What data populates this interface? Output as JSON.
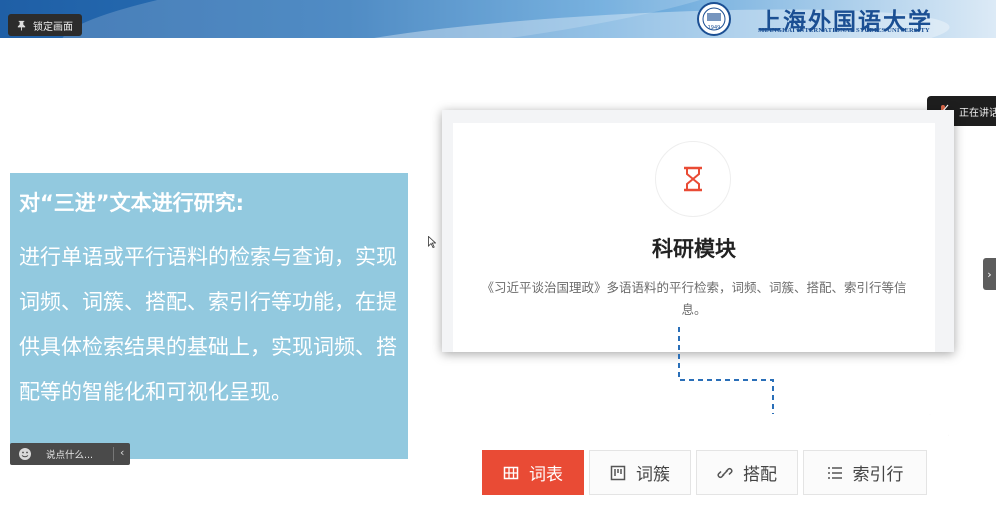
{
  "header": {
    "lock_label": "锁定画面",
    "university_name": "上海外国语大学",
    "university_name_en": "SHANGHAI INTERNATIONAL STUDIES UNIVERSITY",
    "logo_year": "1949"
  },
  "speaking_label": "正在讲话",
  "left_panel": {
    "heading": "对“三进”文本进行研究:",
    "body": "进行单语或平行语料的检索与查询，实现词频、词簇、搭配、索引行等功能，在提供具体检索结果的基础上，实现词频、搭配等的智能化和可视化呈现。"
  },
  "chat": {
    "placeholder": "说点什么...",
    "collapse_glyph": "‹"
  },
  "module_card": {
    "title": "科研模块",
    "description": "《习近平谈治国理政》多语语料的平行检索，词频、词簇、搭配、索引行等信息。",
    "icon": "hourglass-icon",
    "accent_color": "#e94b35"
  },
  "tools": [
    {
      "label": "词表",
      "icon": "table-icon",
      "active": true
    },
    {
      "label": "词簇",
      "icon": "cluster-icon",
      "active": false
    },
    {
      "label": "搭配",
      "icon": "link-icon",
      "active": false
    },
    {
      "label": "索引行",
      "icon": "list-icon",
      "active": false
    }
  ],
  "colors": {
    "panel_blue": "#92c9df",
    "connector_blue": "#2a6fb8",
    "accent_red": "#e94b35"
  }
}
